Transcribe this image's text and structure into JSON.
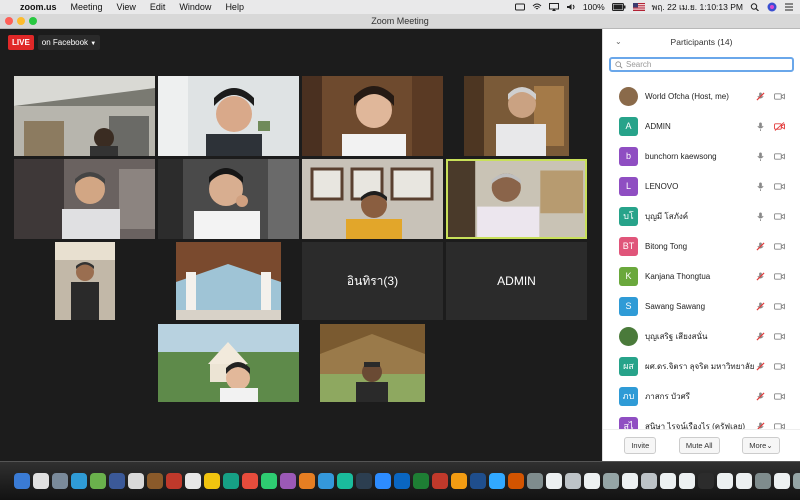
{
  "menubar": {
    "apple": "",
    "app": "zoom.us",
    "items": [
      "Meeting",
      "View",
      "Edit",
      "Window",
      "Help"
    ],
    "battery": "100%",
    "datetime": "พฤ. 22 เม.ย.  1:10:13 PM"
  },
  "window": {
    "title": "Zoom Meeting"
  },
  "live": {
    "badge": "LIVE",
    "label": "on Facebook"
  },
  "gallery": {
    "name_tiles": [
      "อินทิรา(3)",
      "ADMIN"
    ]
  },
  "participants": {
    "title": "Participants (14)",
    "search_placeholder": "Search",
    "list": [
      {
        "name": "World Ofcha (Host, me)",
        "avatar": "",
        "color": "#8a6a4a",
        "mic": "muted",
        "cam": "on"
      },
      {
        "name": "ADMIN",
        "avatar": "A",
        "color": "#27a38a",
        "mic": "on",
        "cam": "off"
      },
      {
        "name": "bunchorn kaewsong",
        "avatar": "b",
        "color": "#8f4ec2",
        "mic": "on",
        "cam": "on"
      },
      {
        "name": "LENOVO",
        "avatar": "L",
        "color": "#8f4ec2",
        "mic": "on",
        "cam": "on"
      },
      {
        "name": "บุญมี  โสภังค์",
        "avatar": "บโ",
        "color": "#27a38a",
        "mic": "on",
        "cam": "on"
      },
      {
        "name": "Bitong Tong",
        "avatar": "BT",
        "color": "#e0557a",
        "mic": "muted",
        "cam": "on"
      },
      {
        "name": "Kanjana Thongtua",
        "avatar": "K",
        "color": "#6aa83c",
        "mic": "muted",
        "cam": "on"
      },
      {
        "name": "Sawang Sawang",
        "avatar": "S",
        "color": "#2f9bd6",
        "mic": "muted",
        "cam": "on"
      },
      {
        "name": "บุญเสริฐ เสียงสนั่น",
        "avatar": "",
        "color": "#4a7a3a",
        "mic": "muted",
        "cam": "on"
      },
      {
        "name": "ผศ.ดร.จิตรา ลุจริต มหาวิทยาลัย...",
        "avatar": "ผส",
        "color": "#27a38a",
        "mic": "muted",
        "cam": "on"
      },
      {
        "name": "ภาสกร บัวศรี",
        "avatar": "ภบ",
        "color": "#2f9bd6",
        "mic": "muted",
        "cam": "on"
      },
      {
        "name": "สุนิษา ไรจน์เรืองไร (ครัฟเลย)",
        "avatar": "สไ",
        "color": "#8f4ec2",
        "mic": "muted",
        "cam": "on"
      }
    ],
    "footer": {
      "invite": "Invite",
      "mute_all": "Mute All",
      "more": "More"
    }
  },
  "colors": {
    "live_red": "#e02828",
    "search_border": "#6aa7ea",
    "muted_red": "#e23b3b",
    "active_speaker": "#c8e05a"
  }
}
